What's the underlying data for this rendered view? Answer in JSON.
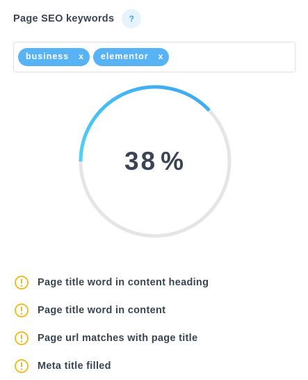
{
  "header": {
    "title": "Page SEO keywords",
    "help_label": "?"
  },
  "keywords": [
    {
      "label": "business",
      "remove_label": "x"
    },
    {
      "label": "elementor",
      "remove_label": "x"
    }
  ],
  "score": {
    "value": "38",
    "unit": "%",
    "progress_fraction": 0.38,
    "accent_gradient": [
      "#4fd1f6",
      "#3ea7ef"
    ],
    "track_color": "#e5e5e5"
  },
  "checks": [
    {
      "icon": "warning-icon",
      "label": "Page title word in content heading"
    },
    {
      "icon": "warning-icon",
      "label": "Page title word in content"
    },
    {
      "icon": "warning-icon",
      "label": "Page url matches with page title"
    },
    {
      "icon": "warning-icon",
      "label": "Meta title filled"
    }
  ],
  "colors": {
    "tag_bg": "#57b3f4",
    "warning": "#f3b712",
    "text": "#3a4453"
  }
}
